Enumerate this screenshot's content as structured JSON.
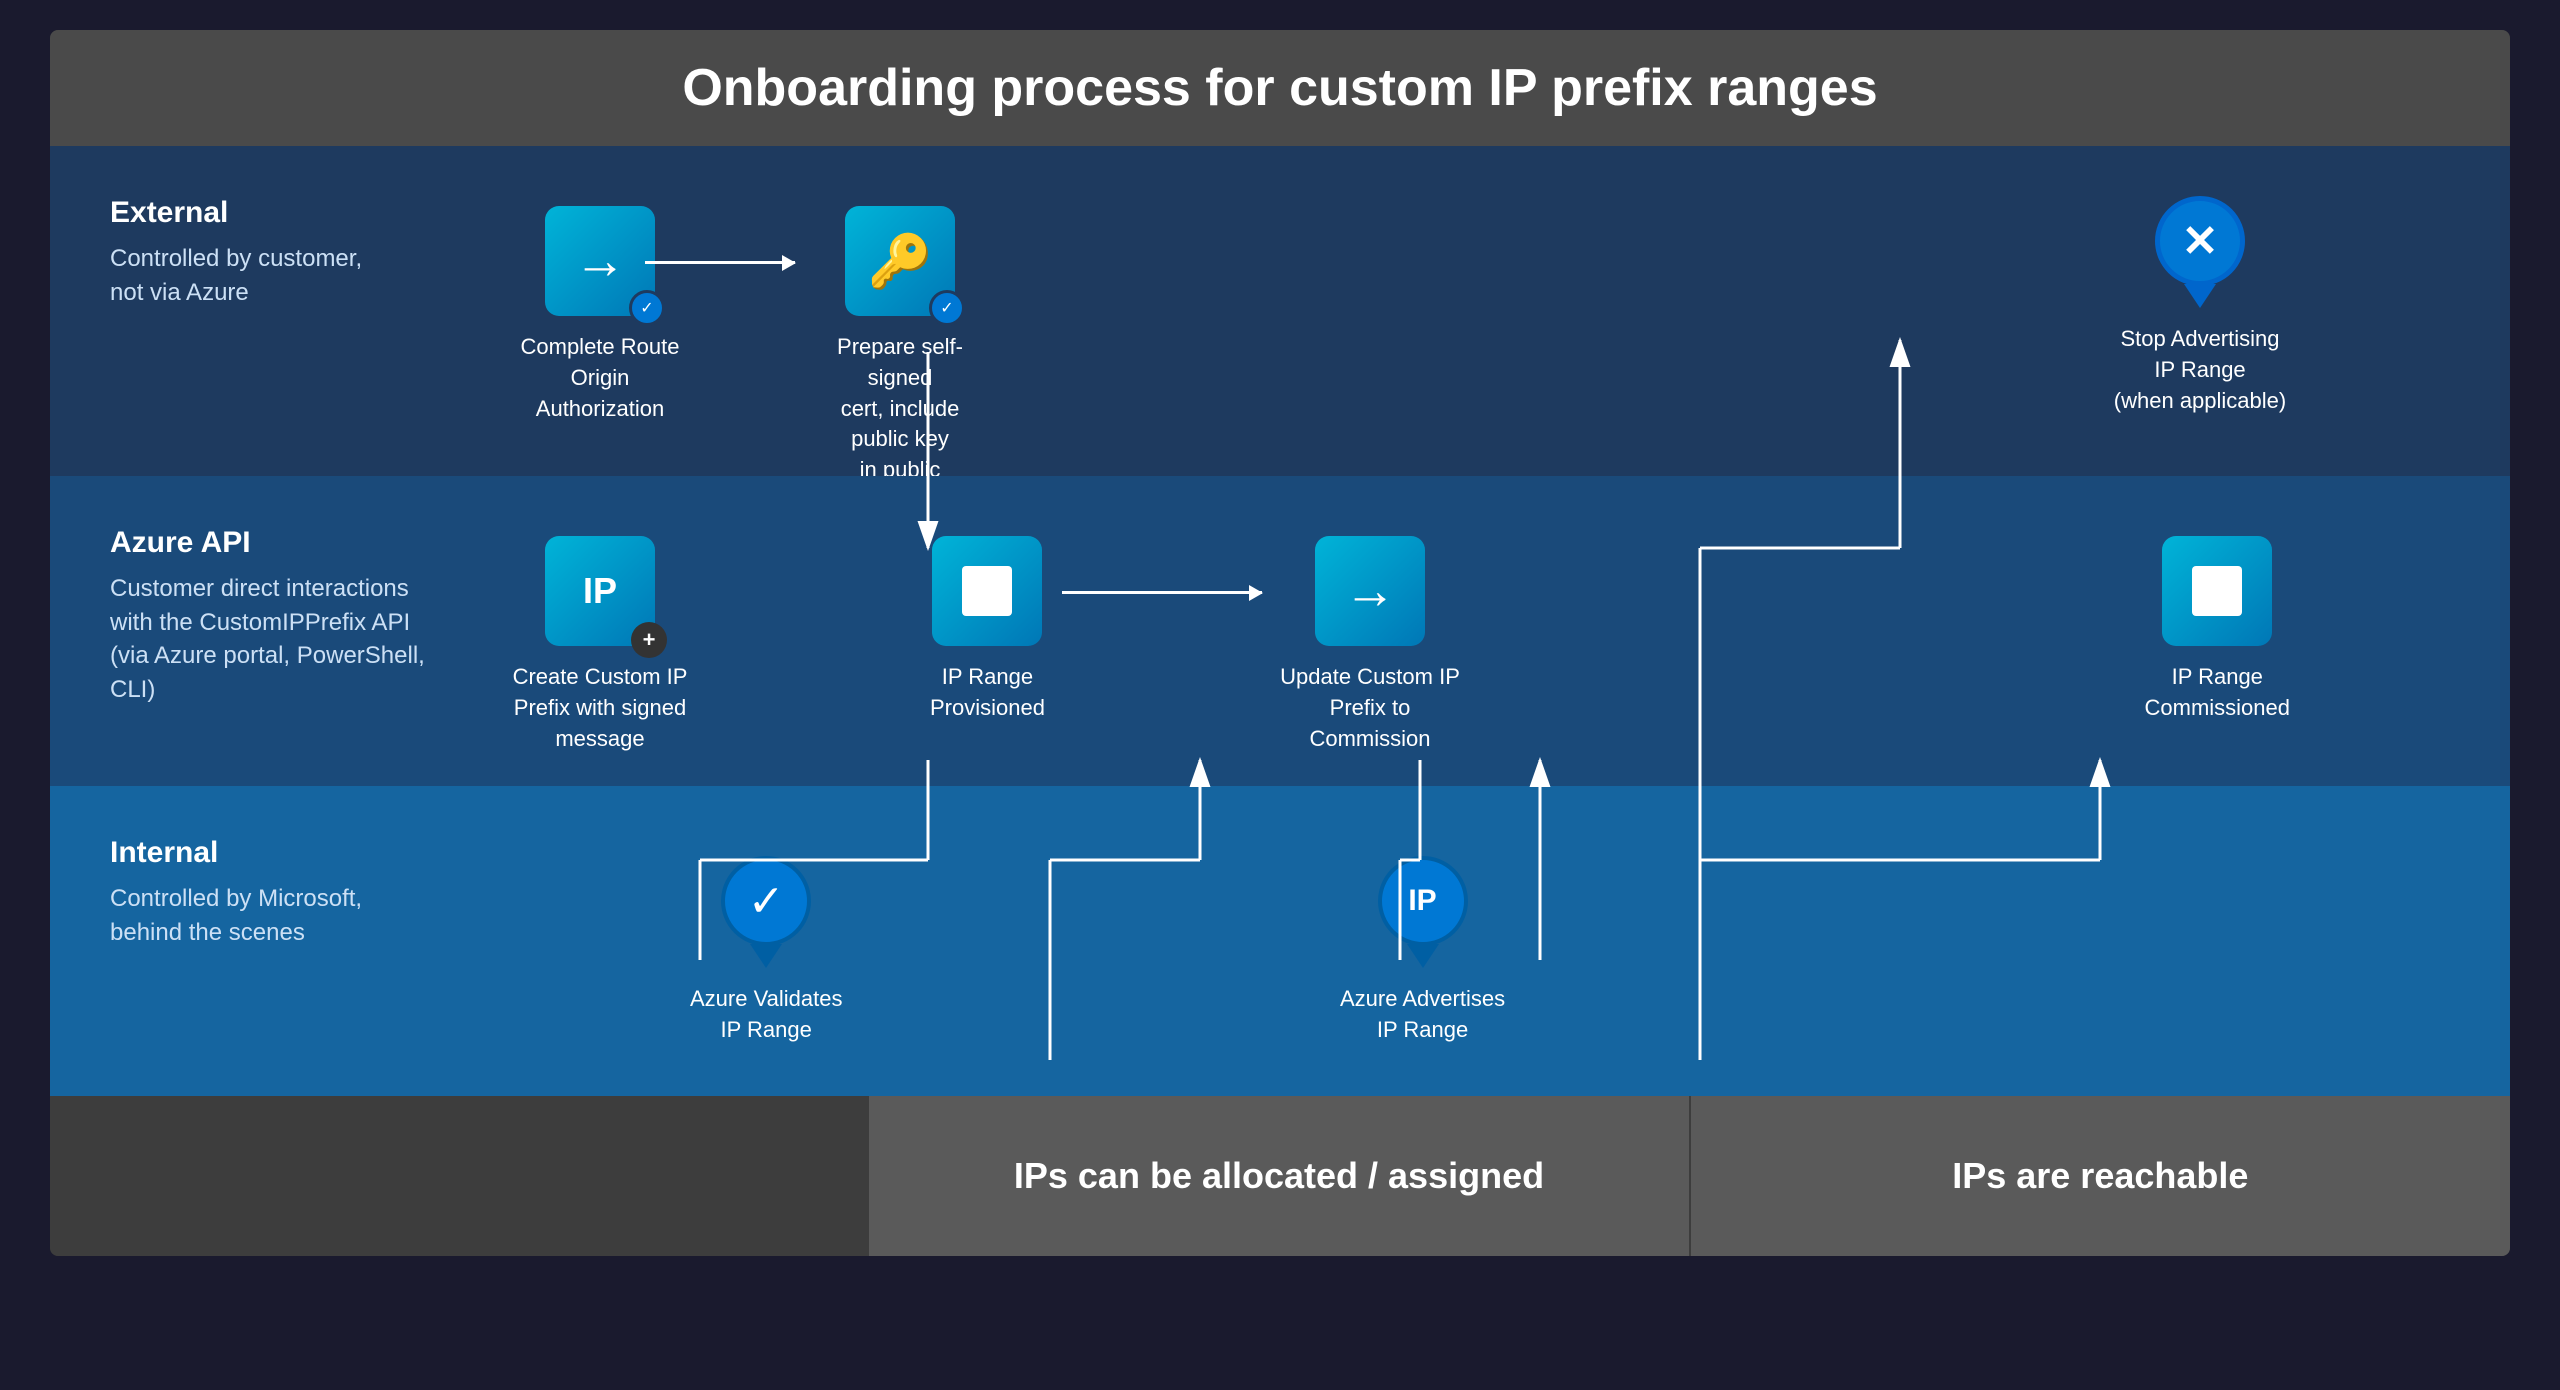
{
  "title": "Onboarding process for custom IP prefix ranges",
  "rows": {
    "external": {
      "label": "External",
      "description": "Controlled by customer,\nnot via Azure",
      "steps": [
        {
          "id": "complete-route",
          "icon": "arrow-right",
          "label": "Complete Route\nOrigin Authorization"
        },
        {
          "id": "prepare-cert",
          "icon": "key",
          "label": "Prepare self-signed\ncert, include public key\nin public comments"
        },
        {
          "id": "stop-advertising",
          "icon": "x-pin",
          "label": "Stop Advertising IP Range\n(when applicable)"
        }
      ]
    },
    "azure": {
      "label": "Azure API",
      "description": "Customer direct interactions\nwith the CustomIPPrefix API\n(via Azure portal, PowerShell, CLI)",
      "steps": [
        {
          "id": "create-custom-ip",
          "icon": "ip-plus",
          "label": "Create Custom IP\nPrefix with signed message"
        },
        {
          "id": "ip-range-provisioned",
          "icon": "stop-square",
          "label": "IP Range\nProvisioned"
        },
        {
          "id": "update-custom-ip",
          "icon": "arrow-right",
          "label": "Update Custom IP\nPrefix to Commission"
        },
        {
          "id": "ip-range-commissioned",
          "icon": "stop-square",
          "label": "IP Range\nCommissioned"
        }
      ]
    },
    "internal": {
      "label": "Internal",
      "description": "Controlled by Microsoft,\nbehind the scenes",
      "steps": [
        {
          "id": "azure-validates",
          "icon": "check-pin",
          "label": "Azure Validates\nIP Range"
        },
        {
          "id": "azure-advertises",
          "icon": "ip-pin",
          "label": "Azure Advertises\nIP Range"
        }
      ]
    }
  },
  "footer": {
    "center_text": "IPs can be allocated / assigned",
    "right_text": "IPs are reachable"
  }
}
